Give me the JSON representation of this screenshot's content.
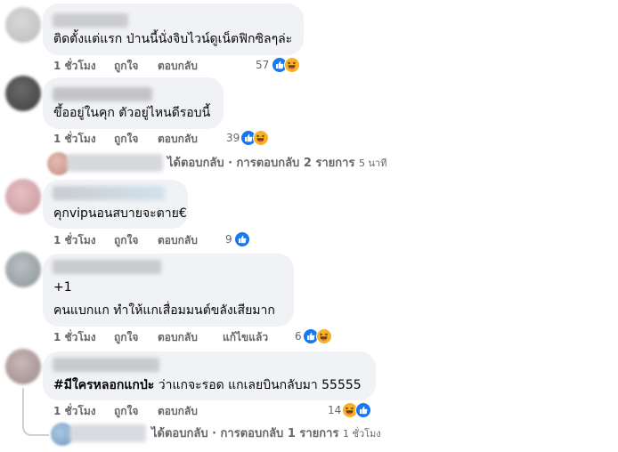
{
  "comments": [
    {
      "text": "ติดตั้งแต่แรก ป่านนี้นั่งจิบไวน์ดูเน็ตฟิกซิลๆล่ะ",
      "time": "1 ชั่วโมง",
      "like": "ถูกใจ",
      "reply": "ตอบกลับ",
      "count": "57",
      "reactions": [
        "like-icon",
        "haha-icon"
      ]
    },
    {
      "text": "ขึ้ออยู่ในคุก ตัวอยู่ไหนดีรอบนี้",
      "time": "1 ชั่วโมง",
      "like": "ถูกใจ",
      "reply": "ตอบกลับ",
      "count": "39",
      "reactions": [
        "like-icon",
        "haha-icon"
      ],
      "replies_summary": {
        "text": "ได้ตอบกลับ · การตอบกลับ 2 รายการ",
        "time": "5 นาที"
      }
    },
    {
      "text": "คุกvipนอนสบายจะตาย€",
      "time": "1 ชั่วโมง",
      "like": "ถูกใจ",
      "reply": "ตอบกลับ",
      "count": "9",
      "reactions": [
        "like-icon"
      ]
    },
    {
      "line1": "+1",
      "line2": "คนแบกแก ทำให้แกเสื่อมมนต์ขลังเสียมาก",
      "time": "1 ชั่วโมง",
      "like": "ถูกใจ",
      "reply": "ตอบกลับ",
      "edited": "แก้ไขแล้ว",
      "count": "6",
      "reactions": [
        "like-icon",
        "haha-icon"
      ]
    },
    {
      "hashtag": "#มีใครหลอกแกป่ะ",
      "text": " ว่าแกจะรอด แกเลยบินกลับมา 55555",
      "time": "1 ชั่วโมง",
      "like": "ถูกใจ",
      "reply": "ตอบกลับ",
      "count": "14",
      "reactions": [
        "haha-icon",
        "like-icon"
      ],
      "replies_summary": {
        "text": "ได้ตอบกลับ · การตอบกลับ 1 รายการ",
        "time": "1 ชั่วโมง"
      }
    }
  ],
  "colors": {
    "bubble": "#f0f2f5",
    "secondary_text": "#65676b",
    "like_blue": "#1877f2",
    "haha_yellow": "#f7b125"
  }
}
